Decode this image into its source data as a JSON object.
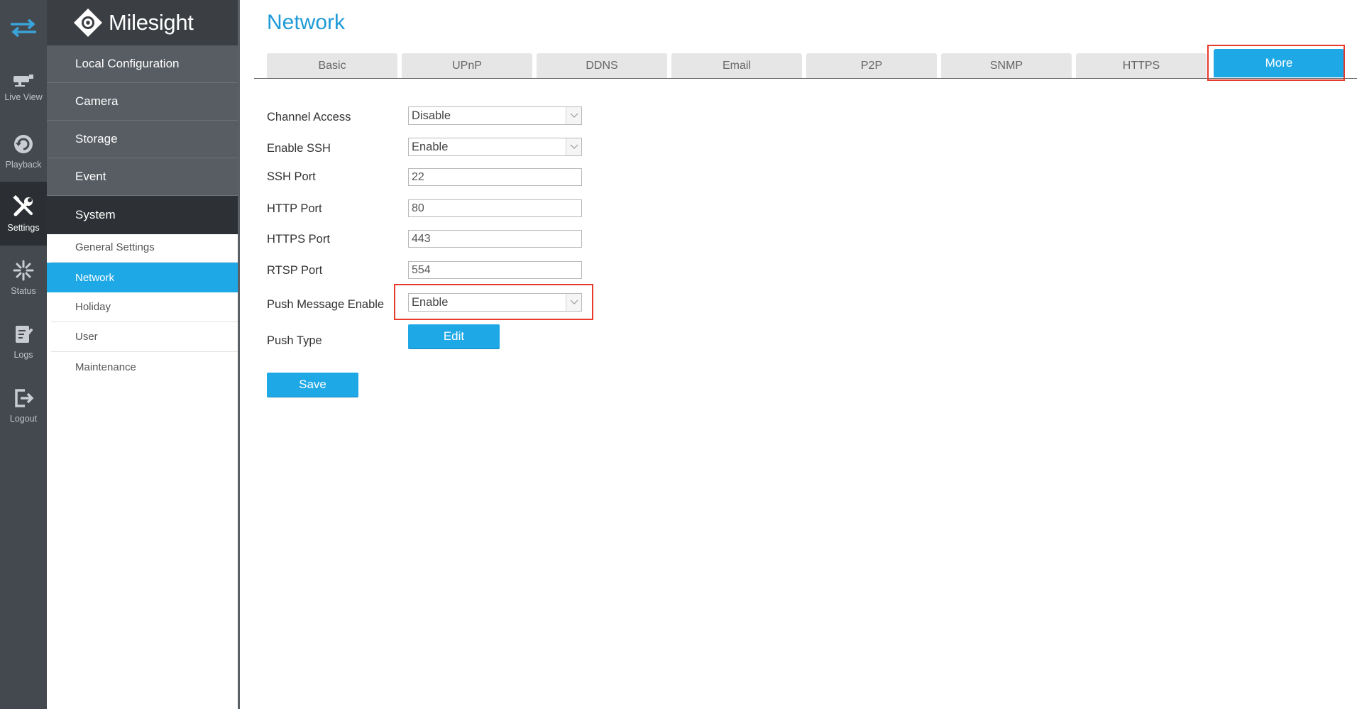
{
  "rail": {
    "items": [
      {
        "label": "Live View",
        "icon": "live-view-icon"
      },
      {
        "label": "Playback",
        "icon": "playback-icon"
      },
      {
        "label": "Settings",
        "icon": "settings-icon"
      },
      {
        "label": "Status",
        "icon": "status-icon"
      },
      {
        "label": "Logs",
        "icon": "logs-icon"
      },
      {
        "label": "Logout",
        "icon": "logout-icon"
      }
    ]
  },
  "brand": {
    "name": "Milesight"
  },
  "menu": {
    "items": [
      {
        "label": "Local Configuration"
      },
      {
        "label": "Camera"
      },
      {
        "label": "Storage"
      },
      {
        "label": "Event"
      },
      {
        "label": "System"
      }
    ],
    "sub_items": [
      {
        "label": "General Settings"
      },
      {
        "label": "Network"
      },
      {
        "label": "Holiday"
      },
      {
        "label": "User"
      },
      {
        "label": "Maintenance"
      }
    ]
  },
  "page": {
    "title": "Network"
  },
  "tabs": [
    {
      "label": "Basic"
    },
    {
      "label": "UPnP"
    },
    {
      "label": "DDNS"
    },
    {
      "label": "Email"
    },
    {
      "label": "P2P"
    },
    {
      "label": "SNMP"
    },
    {
      "label": "HTTPS"
    },
    {
      "label": "More"
    }
  ],
  "form": {
    "channel_access": {
      "label": "Channel Access",
      "value": "Disable"
    },
    "enable_ssh": {
      "label": "Enable SSH",
      "value": "Enable"
    },
    "ssh_port": {
      "label": "SSH Port",
      "value": "22"
    },
    "http_port": {
      "label": "HTTP Port",
      "value": "80"
    },
    "https_port": {
      "label": "HTTPS Port",
      "value": "443"
    },
    "rtsp_port": {
      "label": "RTSP Port",
      "value": "554"
    },
    "push_message_enable": {
      "label": "Push Message Enable",
      "value": "Enable"
    },
    "push_type": {
      "label": "Push Type",
      "button": "Edit"
    },
    "save_label": "Save"
  },
  "colors": {
    "accent": "#1fa8e6",
    "title": "#1e9ad6",
    "highlight": "#e53a2c",
    "rail_bg": "#44494f",
    "menu_bg": "#585d63"
  }
}
